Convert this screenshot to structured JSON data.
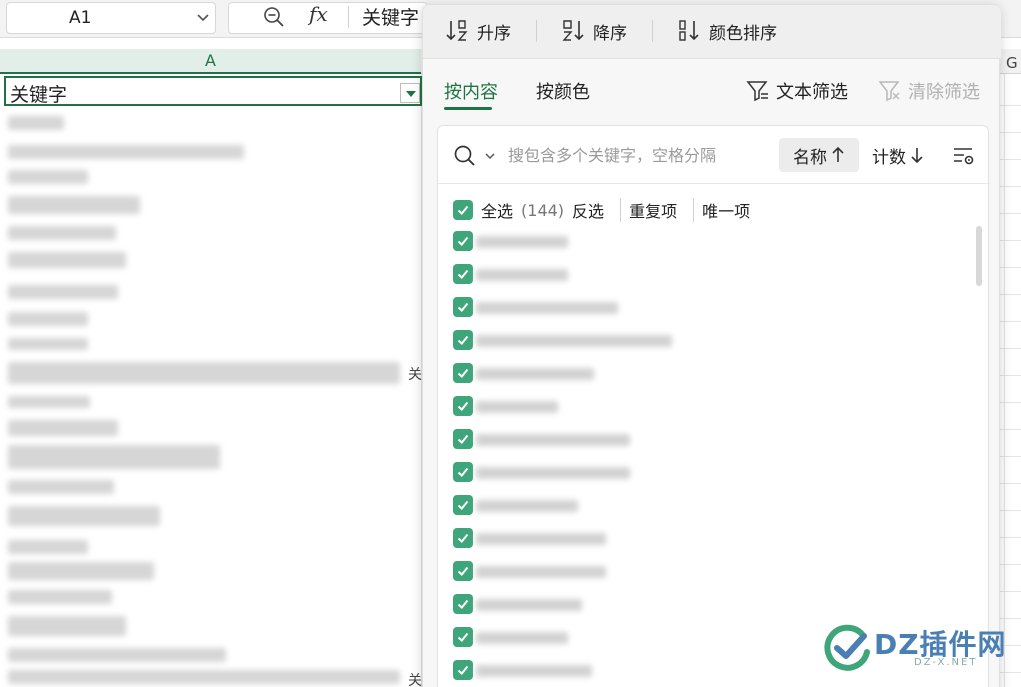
{
  "formula_bar": {
    "name_box": "A1",
    "fx_label": "fx",
    "content": "关键字"
  },
  "column_header": {
    "col_a": "A",
    "col_g": "G"
  },
  "cell_a1": {
    "value": "关键字"
  },
  "clipped_cell_text": "关",
  "filter_panel": {
    "sort": {
      "ascending": "升序",
      "descending": "降序",
      "by_color": "颜色排序"
    },
    "tabs": {
      "by_content": "按内容",
      "by_color": "按颜色"
    },
    "text_filter": "文本筛选",
    "clear_filter": "清除筛选",
    "search": {
      "placeholder": "搜包含多个关键字，空格分隔"
    },
    "list_sort": {
      "by_name": "名称",
      "by_count": "计数"
    },
    "select_all": {
      "label": "全选",
      "count": "(144)",
      "invert": "反选",
      "duplicates": "重复项",
      "unique": "唯一项"
    },
    "accent_color": "#3fa57a"
  },
  "watermark": {
    "main": "DZ插件网",
    "sub": "DZ-X.NET"
  }
}
